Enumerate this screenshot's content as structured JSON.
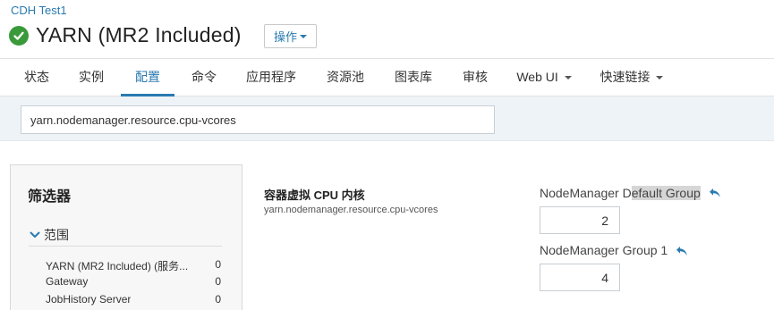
{
  "header": {
    "cluster_link": "CDH Test1",
    "service_name": "YARN (MR2 Included)",
    "actions_label": "操作",
    "status_color": "#3a9a3a"
  },
  "tabs": [
    {
      "label": "状态"
    },
    {
      "label": "实例"
    },
    {
      "label": "配置",
      "active": true
    },
    {
      "label": "命令"
    },
    {
      "label": "应用程序"
    },
    {
      "label": "资源池"
    },
    {
      "label": "图表库"
    },
    {
      "label": "审核"
    },
    {
      "label": "Web UI",
      "dropdown": true
    },
    {
      "label": "快速链接",
      "dropdown": true
    }
  ],
  "search": {
    "value": "yarn.nodemanager.resource.cpu-vcores"
  },
  "filters": {
    "title": "筛选器",
    "scope_label": "范围",
    "scope_items": [
      {
        "name": "YARN (MR2 Included) (服务...",
        "count": "0"
      },
      {
        "name": "Gateway",
        "count": "0"
      },
      {
        "name": "JobHistory Server",
        "count": "0"
      }
    ]
  },
  "property": {
    "label": "容器虚拟 CPU 内核",
    "key": "yarn.nodemanager.resource.cpu-vcores",
    "groups": [
      {
        "label_pre": "NodeManager D",
        "label_hl": "efault Group",
        "value": "2"
      },
      {
        "label_pre": "NodeManager Group 1",
        "label_hl": "",
        "value": "4"
      }
    ]
  },
  "accent_color": "#2a7ab0"
}
